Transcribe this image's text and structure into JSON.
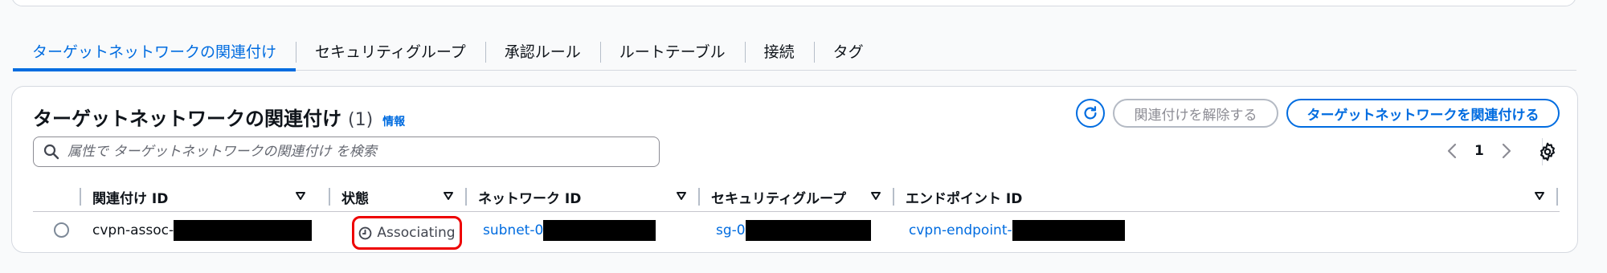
{
  "tabs": [
    {
      "label": "ターゲットネットワークの関連付け",
      "active": true
    },
    {
      "label": "セキュリティグループ",
      "active": false
    },
    {
      "label": "承認ルール",
      "active": false
    },
    {
      "label": "ルートテーブル",
      "active": false
    },
    {
      "label": "接続",
      "active": false
    },
    {
      "label": "タグ",
      "active": false
    }
  ],
  "panel": {
    "title": "ターゲットネットワークの関連付け",
    "count": "(1)",
    "info_link": "情報",
    "disassociate_button": "関連付けを解除する",
    "associate_button": "ターゲットネットワークを関連付ける"
  },
  "search": {
    "placeholder": "属性で ターゲットネットワークの関連付け を検索"
  },
  "pagination": {
    "current_page": "1"
  },
  "table": {
    "columns": [
      "関連付け ID",
      "状態",
      "ネットワーク ID",
      "セキュリティグループ",
      "エンドポイント ID"
    ],
    "rows": [
      {
        "association_id": "cvpn-assoc-",
        "status": "Associating",
        "network_id": "subnet-0",
        "security_group": "sg-0",
        "endpoint_id": "cvpn-endpoint-"
      }
    ]
  },
  "colors": {
    "accent": "#006ce0",
    "highlight_outline": "#ee0000",
    "redaction": "#000000"
  },
  "icons": [
    "refresh-icon",
    "search-icon",
    "chevron-left-icon",
    "chevron-right-icon",
    "gear-icon",
    "sort-caret-icon",
    "pending-clock-icon"
  ]
}
